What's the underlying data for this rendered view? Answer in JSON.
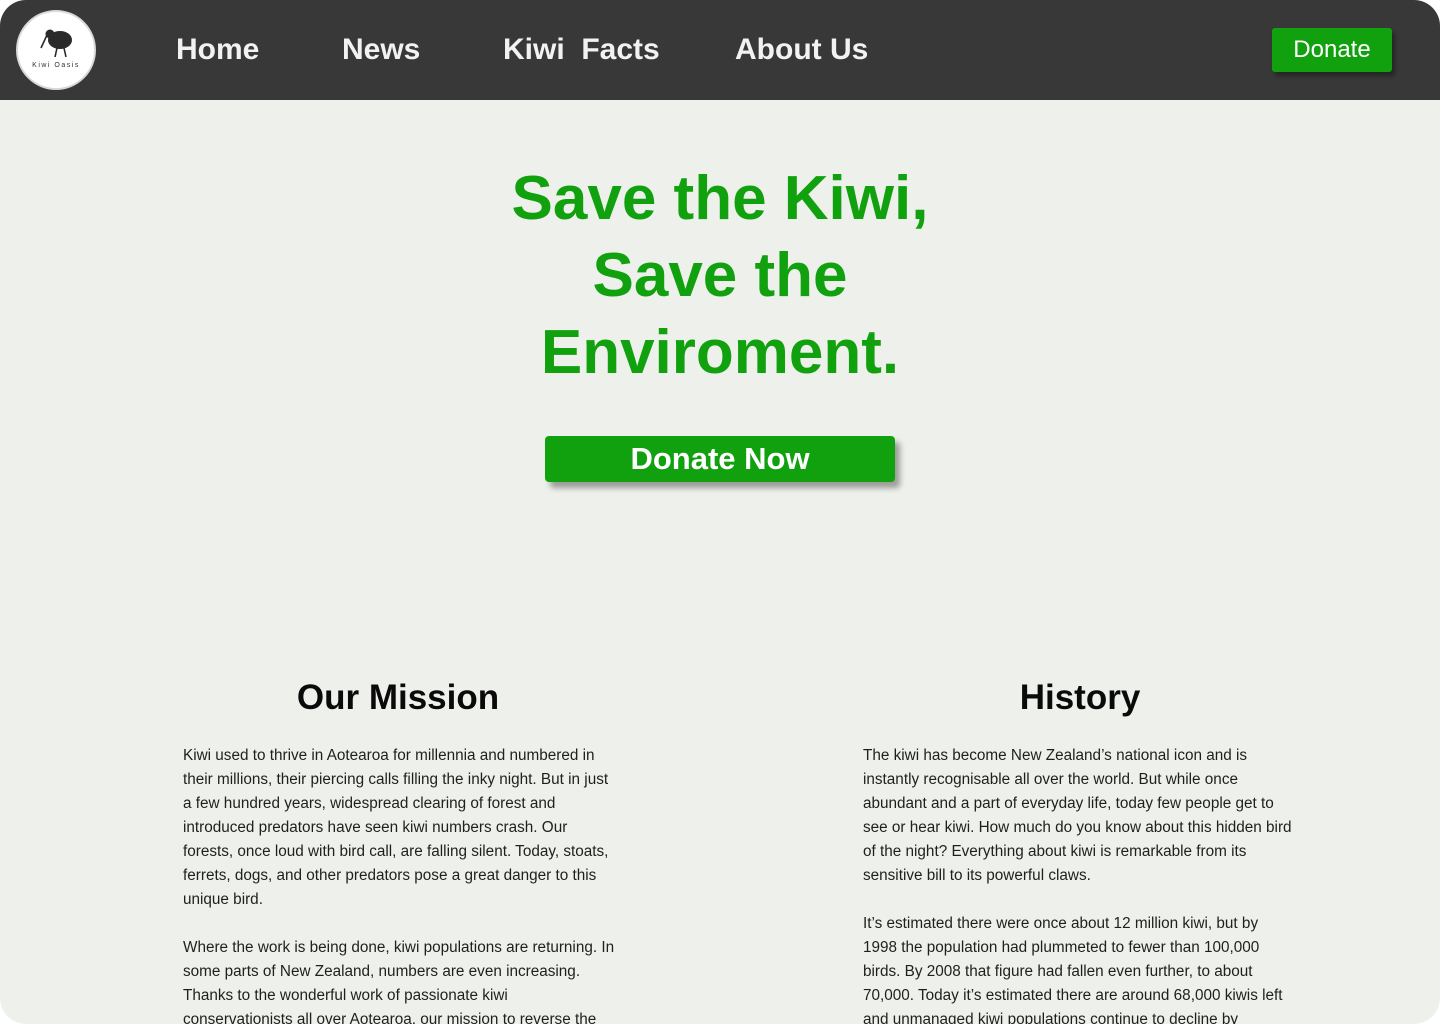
{
  "header": {
    "logo": {
      "icon": "kiwi-bird-icon",
      "text": "Kiwi Oasis"
    },
    "nav": [
      {
        "label": "Home"
      },
      {
        "label": "News"
      },
      {
        "label": "Kiwi  Facts"
      },
      {
        "label": "About Us"
      }
    ],
    "donate_label": "Donate"
  },
  "hero": {
    "title_lines": [
      "Save the Kiwi,",
      "Save the",
      "Enviroment."
    ],
    "cta_label": "Donate Now"
  },
  "mission": {
    "title": "Our Mission",
    "paragraphs": [
      "Kiwi used to thrive in Aotearoa for millennia and numbered in their millions, their piercing calls filling the inky night. But in just a few hundred years, widespread clearing of forest and introduced predators have seen kiwi numbers crash. Our forests, once loud with bird call, are falling silent. Today, stoats, ferrets, dogs, and other predators pose a great danger to this unique bird.",
      "Where the work is being done, kiwi populations are returning. In some parts of New Zealand, numbers are even increasing. Thanks to the wonderful work of passionate kiwi conservationists all over Aotearoa, our mission to reverse the"
    ]
  },
  "history": {
    "title": "History",
    "paragraphs": [
      "The kiwi has become New Zealand’s national icon and is instantly recognisable all over the world. But while once abundant and a part of everyday life, today few people get to see or hear kiwi. How much do you know about this hidden bird of the night? Everything about kiwi is remarkable from its sensitive bill to its powerful claws.",
      "It’s estimated there were once about 12 million kiwi, but by 1998 the population had plummeted to fewer than 100,000 birds. By 2008 that figure had fallen even further, to about 70,000. Today it’s estimated there are around 68,000 kiwis left and unmanaged kiwi populations continue to decline by"
    ]
  },
  "colors": {
    "accent": "#12a10e",
    "navbar": "#383838",
    "background": "#eef0eb"
  }
}
